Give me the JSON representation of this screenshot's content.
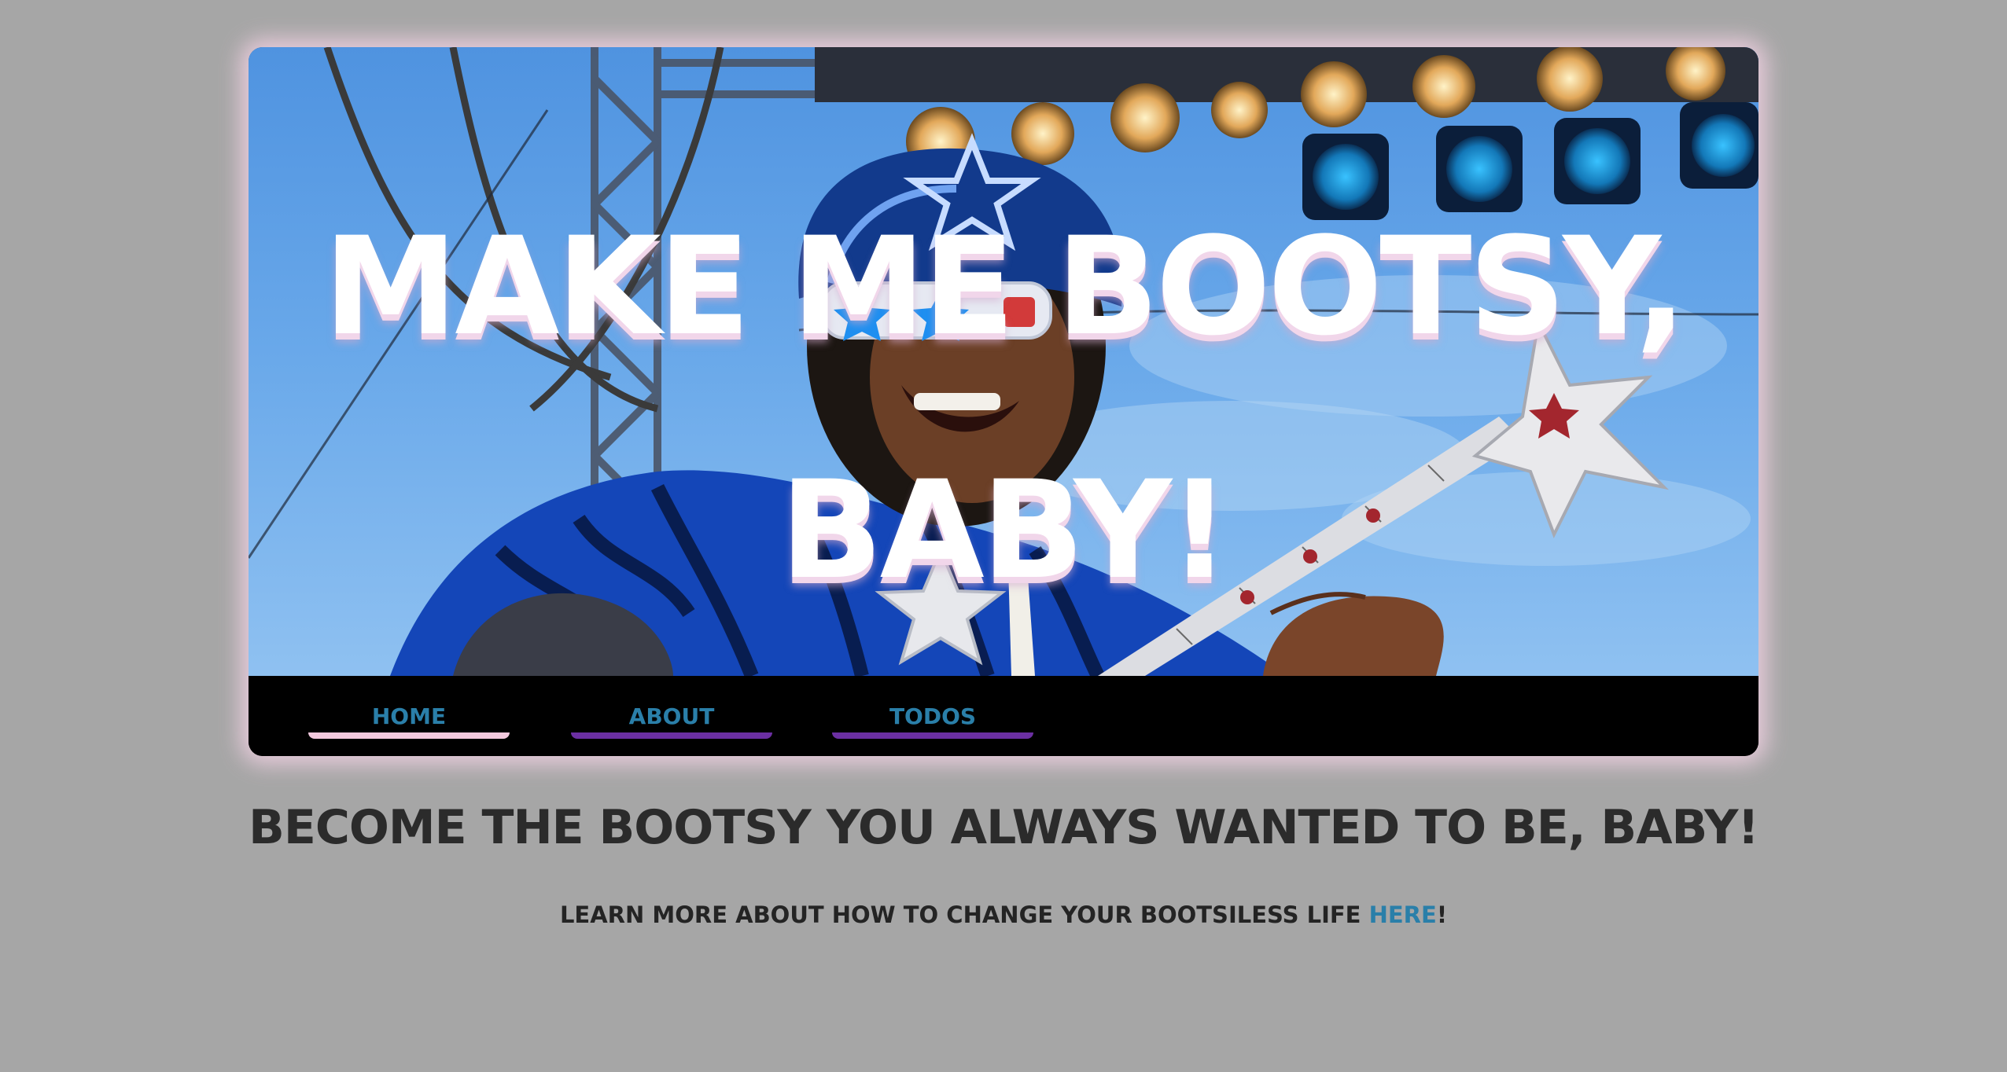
{
  "page": {
    "background_color": "#a6a6a6",
    "card_glow_color": "#ecccde"
  },
  "hero": {
    "title_line1": "MAKE ME BOOTSY,",
    "title_line2": "BABY!",
    "image_description_icon": "concert-guitarist-photo"
  },
  "nav": {
    "items": [
      {
        "label": "HOME",
        "active": true
      },
      {
        "label": "ABOUT",
        "active": false
      },
      {
        "label": "TODOS",
        "active": false
      }
    ],
    "link_color": "#2a7fa9",
    "active_underline_color": "#f3c9de",
    "inactive_underline_color": "#6b2fa2"
  },
  "main": {
    "headline": "BECOME THE BOOTSY YOU ALWAYS WANTED TO BE, BABY!",
    "subline_prefix": "LEARN MORE ABOUT HOW TO CHANGE YOUR BOOTSILESS LIFE ",
    "subline_link": "HERE",
    "subline_suffix": "!"
  }
}
